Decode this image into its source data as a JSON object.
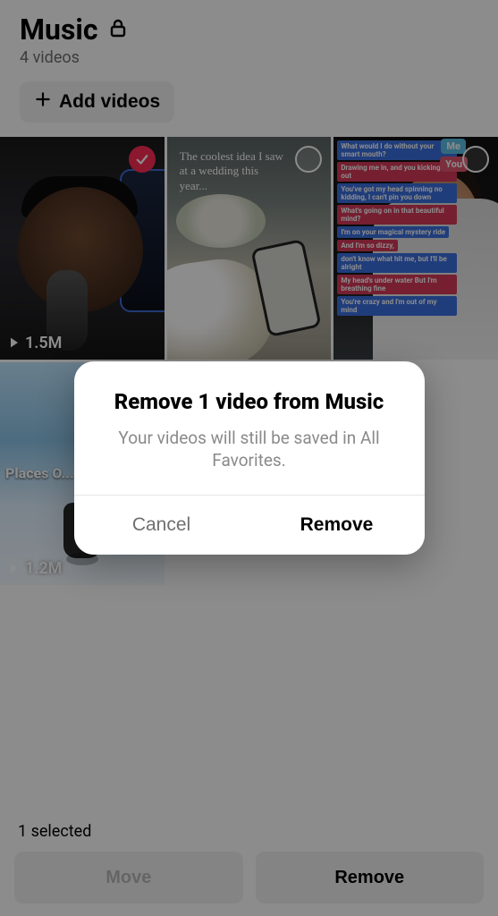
{
  "header": {
    "title": "Music",
    "subtitle": "4 videos",
    "add_button_label": "Add videos"
  },
  "grid": {
    "items": [
      {
        "views": "1.5M",
        "selected": true
      },
      {
        "caption": "The coolest idea I saw at a wedding this year...",
        "selected": false
      },
      {
        "tags": {
          "me": "Me",
          "you": "You"
        },
        "lyrics": [
          {
            "text": "What would I do without your smart mouth?",
            "bg": "#3b6fe0"
          },
          {
            "text": "Drawing me in, and you kicking me out",
            "bg": "#d63a5a"
          },
          {
            "text": "You've got my head spinning no kidding, I can't pin you down",
            "bg": "#3b6fe0"
          },
          {
            "text": "What's going on in that beautiful mind?",
            "bg": "#d63a5a"
          },
          {
            "text": "I'm on your magical mystery ride",
            "bg": "#3b6fe0"
          },
          {
            "text": "And I'm so dizzy,",
            "bg": "#d63a5a"
          },
          {
            "text": "don't know what hit me, but I'll be alright",
            "bg": "#3b6fe0"
          },
          {
            "text": "My head's under water But I'm breathing fine",
            "bg": "#d63a5a"
          },
          {
            "text": "You're crazy and I'm out of my mind",
            "bg": "#3b6fe0"
          }
        ],
        "selected": false
      },
      {
        "views": "1.2M",
        "caption": "Places O...  Don't F...",
        "selected": false
      }
    ]
  },
  "bottombar": {
    "selected_text": "1 selected",
    "move_label": "Move",
    "remove_label": "Remove"
  },
  "dialog": {
    "title": "Remove 1 video from Music",
    "message": "Your videos will still be saved in All Favorites.",
    "cancel_label": "Cancel",
    "confirm_label": "Remove"
  }
}
